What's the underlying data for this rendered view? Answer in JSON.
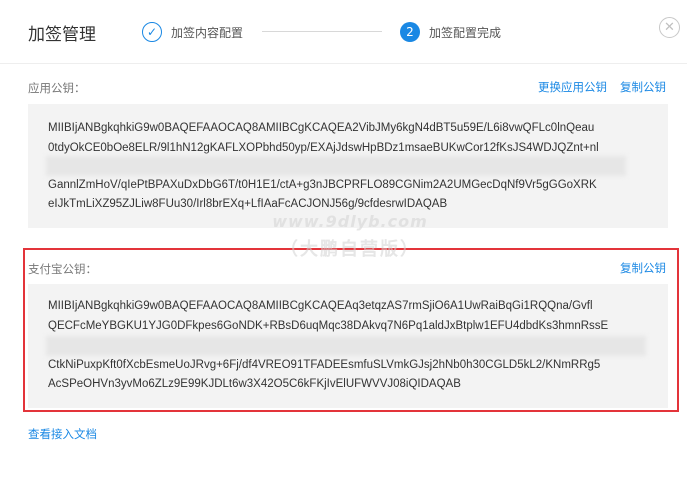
{
  "header": {
    "title": "加签管理",
    "close_glyph": "✕",
    "steps": [
      {
        "number": "1",
        "label": "加签内容配置",
        "status": "done",
        "check": "✓"
      },
      {
        "number": "2",
        "label": "加签配置完成",
        "status": "active"
      }
    ]
  },
  "app_public_key": {
    "label": "应用公钥：",
    "change_link": "更换应用公钥",
    "copy_link": "复制公钥",
    "lines": [
      "MIIBIjANBgkqhkiG9w0BAQEFAAOCAQ8AMIIBCgKCAQEA2VibJMy6kgN4dBT5u59E/L6i8vwQFLc0lnQeau",
      "0tdyOkCE0bOe8ELR/9l1hN12gKAFLXOPbhd50yp/EXAjJdswHpBDz1msaeBUKwCor12fKsJS4WDJQZnt+nl",
      "GannlZmHoV/qIePtBPAXuDxDbG6T/t0H1E1/ctA+g3nJBCPRFLO89CGNim2A2UMGecDqNf9Vr5gGGoXRK",
      "eIJkTmLiXZ95ZJLiw8FUu30/Irl8brEXq+LfIAaFcACJONJ56g/9cfdesrwIDAQAB"
    ]
  },
  "alipay_public_key": {
    "label": "支付宝公钥：",
    "copy_link": "复制公钥",
    "lines": [
      "MIIBIjANBgkqhkiG9w0BAQEFAAOCAQ8AMIIBCgKCAQEAq3etqzAS7rmSjiO6A1UwRaiBqGi1RQQna/Gvfl",
      "QECFcMeYBGKU1YJG0DFkpes6GoNDK+RBsD6uqMqc38DAkvq7N6Pq1aldJxBtplw1EFU4dbdKs3hmnRssE",
      "CtkNiPuxpKft0fXcbEsmeUoJRvg+6Fj/df4VREO91TFADEEsmfuSLVmkGJsj2hNb0h30CGLD5kL2/KNmRRg5",
      "AcSPeOHVn3yvMo6ZLz9E99KJDLt6w3X42O5C6kFKjIvElUFWVVJ08iQIDAQAB"
    ]
  },
  "footer": {
    "doc_link": "查看接入文档"
  },
  "watermark": {
    "line1": "www.9dlyb.com",
    "line2": "（大鹏自营版）"
  }
}
